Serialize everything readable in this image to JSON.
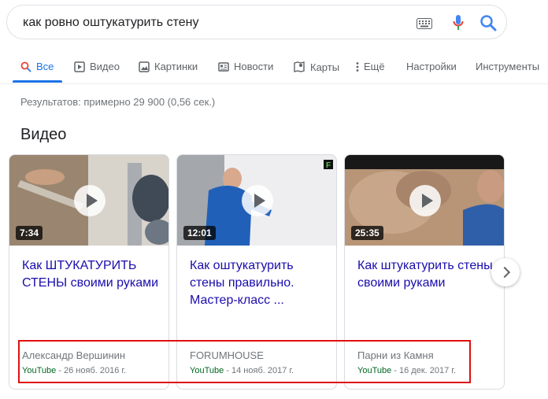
{
  "search": {
    "query": "как ровно оштукатурить стену"
  },
  "tabs": [
    {
      "label": "Все",
      "icon": "search-icon",
      "active": true
    },
    {
      "label": "Видео",
      "icon": "video-icon"
    },
    {
      "label": "Картинки",
      "icon": "image-icon"
    },
    {
      "label": "Новости",
      "icon": "news-icon"
    },
    {
      "label": "Карты",
      "icon": "map-pin-icon"
    },
    {
      "label": "Ещё",
      "icon": "more-vertical-icon"
    },
    {
      "label": "Настройки"
    },
    {
      "label": "Инструменты"
    }
  ],
  "stats": "Результатов: примерно 29 900 (0,56 сек.)",
  "section_title": "Видео",
  "videos": [
    {
      "duration": "7:34",
      "title": "Как ШТУКАТУРИТЬ СТЕНЫ своими руками",
      "channel": "Александр Вершинин",
      "source": "YouTube",
      "date": " - 26 нояб. 2016 г."
    },
    {
      "duration": "12:01",
      "title": "Как оштукатурить стены правильно. Мастер-класс ...",
      "channel": "FORUMHOUSE",
      "source": "YouTube",
      "date": " - 14 нояб. 2017 г."
    },
    {
      "duration": "25:35",
      "title": "Как штукатурить стены своими руками",
      "channel": "Парни из Камня",
      "source": "YouTube",
      "date": " - 16 дек. 2017 г."
    }
  ],
  "colors": {
    "link": "#1a0dab",
    "accent": "#1a73e8",
    "youtube_source": "#006621",
    "highlight": "#e01010"
  }
}
